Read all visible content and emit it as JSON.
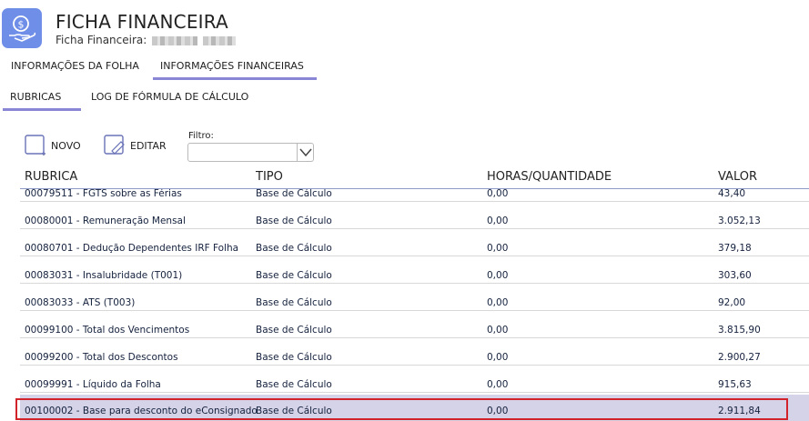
{
  "header": {
    "title": "FICHA FINANCEIRA",
    "subtitle_label": "Ficha Financeira:"
  },
  "colors": {
    "accent": "#8a86d6",
    "icon_bg": "#6f8ee8",
    "selected_row": "#d5d3e8",
    "highlight": "#d2232a"
  },
  "main_tabs": [
    {
      "label": "INFORMAÇÕES DA FOLHA",
      "active": false
    },
    {
      "label": "INFORMAÇÕES FINANCEIRAS",
      "active": true
    }
  ],
  "sub_tabs": [
    {
      "label": "RUBRICAS",
      "active": true
    },
    {
      "label": "LOG DE FÓRMULA DE CÁLCULO",
      "active": false
    }
  ],
  "toolbar": {
    "novo_label": "NOVO",
    "editar_label": "EDITAR",
    "filter_label": "Filtro:",
    "filter_value": ""
  },
  "table": {
    "columns": [
      "RUBRICA",
      "TIPO",
      "HORAS/QUANTIDADE",
      "VALOR"
    ],
    "rows": [
      {
        "rubrica": "00079511 - FGTS sobre as Férias",
        "tipo": "Base de Cálculo",
        "horas": "0,00",
        "valor": "43,40"
      },
      {
        "rubrica": "00080001 - Remuneração Mensal",
        "tipo": "Base de Cálculo",
        "horas": "0,00",
        "valor": "3.052,13"
      },
      {
        "rubrica": "00080701 - Dedução Dependentes IRF Folha",
        "tipo": "Base de Cálculo",
        "horas": "0,00",
        "valor": "379,18"
      },
      {
        "rubrica": "00083031 - Insalubridade (T001)",
        "tipo": "Base de Cálculo",
        "horas": "0,00",
        "valor": "303,60"
      },
      {
        "rubrica": "00083033 - ATS (T003)",
        "tipo": "Base de Cálculo",
        "horas": "0,00",
        "valor": "92,00"
      },
      {
        "rubrica": "00099100 - Total dos Vencimentos",
        "tipo": "Base de Cálculo",
        "horas": "0,00",
        "valor": "3.815,90"
      },
      {
        "rubrica": "00099200 - Total dos Descontos",
        "tipo": "Base de Cálculo",
        "horas": "0,00",
        "valor": "2.900,27"
      },
      {
        "rubrica": "00099991 - Líquido da Folha",
        "tipo": "Base de Cálculo",
        "horas": "0,00",
        "valor": "915,63"
      },
      {
        "rubrica": "00100002 - Base para desconto do eConsignado",
        "tipo": "Base de Cálculo",
        "horas": "0,00",
        "valor": "2.911,84",
        "selected": true
      }
    ]
  }
}
